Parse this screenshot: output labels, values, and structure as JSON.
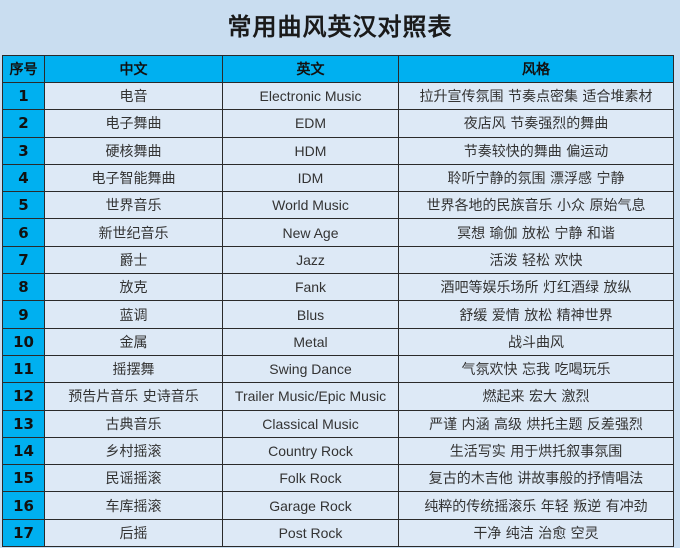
{
  "title": "常用曲风英汉对照表",
  "header": {
    "index": "序号",
    "chinese": "中文",
    "english": "英文",
    "style": "风格"
  },
  "rows": [
    {
      "index": "1",
      "chinese": "电音",
      "english": "Electronic Music",
      "style": "拉升宣传氛围 节奏点密集 适合堆素材"
    },
    {
      "index": "2",
      "chinese": "电子舞曲",
      "english": "EDM",
      "style": "夜店风 节奏强烈的舞曲"
    },
    {
      "index": "3",
      "chinese": "硬核舞曲",
      "english": "HDM",
      "style": "节奏较快的舞曲 偏运动"
    },
    {
      "index": "4",
      "chinese": "电子智能舞曲",
      "english": "IDM",
      "style": "聆听宁静的氛围 漂浮感 宁静"
    },
    {
      "index": "5",
      "chinese": "世界音乐",
      "english": "World Music",
      "style": "世界各地的民族音乐 小众 原始气息"
    },
    {
      "index": "6",
      "chinese": "新世纪音乐",
      "english": "New Age",
      "style": "冥想 瑜伽 放松 宁静 和谐"
    },
    {
      "index": "7",
      "chinese": "爵士",
      "english": "Jazz",
      "style": "活泼 轻松 欢快"
    },
    {
      "index": "8",
      "chinese": "放克",
      "english": "Fank",
      "style": "酒吧等娱乐场所 灯红酒绿 放纵"
    },
    {
      "index": "9",
      "chinese": "蓝调",
      "english": "Blus",
      "style": "舒缓 爱情 放松 精神世界"
    },
    {
      "index": "10",
      "chinese": "金属",
      "english": "Metal",
      "style": "战斗曲风"
    },
    {
      "index": "11",
      "chinese": "摇摆舞",
      "english": "Swing Dance",
      "style": "气氛欢快 忘我 吃喝玩乐"
    },
    {
      "index": "12",
      "chinese": "预告片音乐 史诗音乐",
      "english": "Trailer Music/Epic Music",
      "style": "燃起来 宏大 激烈"
    },
    {
      "index": "13",
      "chinese": "古典音乐",
      "english": "Classical Music",
      "style": "严谨 内涵 高级 烘托主题 反差强烈"
    },
    {
      "index": "14",
      "chinese": "乡村摇滚",
      "english": "Country Rock",
      "style": "生活写实 用于烘托叙事氛围"
    },
    {
      "index": "15",
      "chinese": "民谣摇滚",
      "english": "Folk Rock",
      "style": "复古的木吉他 讲故事般的抒情唱法"
    },
    {
      "index": "16",
      "chinese": "车库摇滚",
      "english": "Garage Rock",
      "style": "纯粹的传统摇滚乐 年轻 叛逆 有冲劲"
    },
    {
      "index": "17",
      "chinese": "后摇",
      "english": "Post Rock",
      "style": "干净 纯洁 治愈 空灵"
    }
  ],
  "colors": {
    "background": "#c9ddf0",
    "header_fill": "#00b0f0",
    "cell_fill": "#dde9f6",
    "border": "#2a2a2a"
  }
}
